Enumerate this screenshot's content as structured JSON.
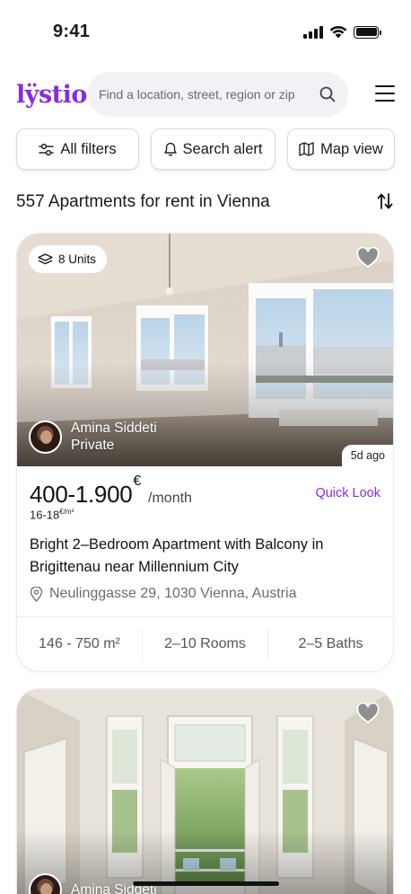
{
  "status_bar": {
    "time": "9:41"
  },
  "header": {
    "logo": "lÿstio",
    "search_placeholder": "Find a location, street, region or zip"
  },
  "filters": {
    "all_filters": "All filters",
    "search_alert": "Search alert",
    "map_view": "Map view"
  },
  "results_title": "557 Apartments for rent in Vienna",
  "listings": [
    {
      "units_badge": "8 Units",
      "owner_name": "Amina Siddeti",
      "owner_type": "Private",
      "age": "5d ago",
      "price": "400-1.900",
      "currency": "€",
      "period": "/month",
      "price_per_sqm": "16-18",
      "price_per_sqm_unit": "€",
      "price_per_sqm_suffix": "/m²",
      "quick_look": "Quick Look",
      "title": "Bright 2–Bedroom Apartment with Balcony in Brigittenau near Millennium City",
      "address": "Neulinggasse 29, 1030 Vienna, Austria",
      "area": "146 - 750 m²",
      "rooms": "2–10 Rooms",
      "baths": "2–5 Baths"
    },
    {
      "owner_name": "Amina Siddeti"
    }
  ],
  "colors": {
    "accent": "#8a2be2"
  },
  "icons": [
    "sliders-icon",
    "bell-icon",
    "map-icon",
    "sort-icon",
    "search-icon",
    "menu-icon",
    "layers-icon",
    "heart-icon",
    "location-pin-icon"
  ]
}
